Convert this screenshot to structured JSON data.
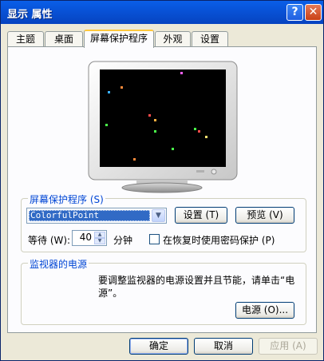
{
  "window": {
    "title": "显示 属性",
    "help_glyph": "?",
    "close_glyph": "✕"
  },
  "tabs": [
    {
      "label": "主题",
      "active": false
    },
    {
      "label": "桌面",
      "active": false
    },
    {
      "label": "屏幕保护程序",
      "active": true
    },
    {
      "label": "外观",
      "active": false
    },
    {
      "label": "设置",
      "active": false
    }
  ],
  "screensaver": {
    "group_label": "屏幕保护程序 (S)",
    "selected": "ColorfulPoint",
    "settings_button": "设置 (T)",
    "preview_button": "预览 (V)",
    "wait_label": "等待 (W):",
    "wait_value": "40",
    "wait_unit": "分钟",
    "password_checkbox_label": "在恢复时使用密码保护 (P)",
    "password_checked": false,
    "preview_points_colors": [
      "#ff8a3a",
      "#ff60ff",
      "#ffb040",
      "#4aff4a",
      "#3ab0ff",
      "#ff4a4a",
      "#ffe070"
    ]
  },
  "power": {
    "group_label": "监视器的电源",
    "description_line1": "要调整监视器的电源设置并且节能，请单击“电",
    "description_line2": "源”。",
    "power_button": "电源 (O)..."
  },
  "footer": {
    "ok": "确定",
    "cancel": "取消",
    "apply": "应用 (A)"
  }
}
